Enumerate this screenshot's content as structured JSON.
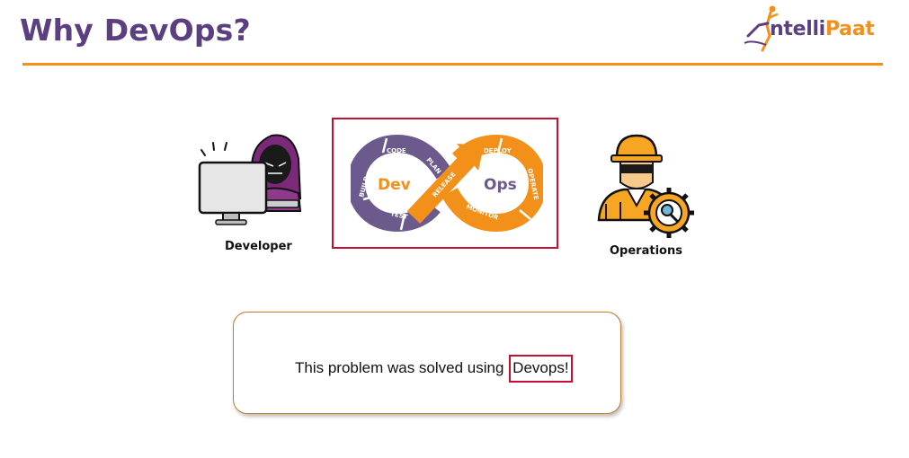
{
  "slide": {
    "title": "Why DevOps?"
  },
  "logo": {
    "text_prefix": "ntelli",
    "text_suffix": "Paat",
    "prefix_color": "#5b3f80",
    "suffix_color": "#f39019"
  },
  "figures": {
    "developer_label": "Developer",
    "operations_label": "Operations"
  },
  "devops_loop": {
    "left_word": "Dev",
    "right_word": "Ops",
    "stages": {
      "code": "CODE",
      "plan": "PLAN",
      "build": "BUILD",
      "test": "TEST",
      "release": "RELEASE",
      "deploy": "DEPLOY",
      "operate": "OPERATE",
      "monitor": "MONITOR"
    },
    "dev_color": "#6c5a8c",
    "ops_color": "#f39019"
  },
  "message": {
    "text": "This problem was solved using ",
    "highlight": "Devops!"
  },
  "colors": {
    "title": "#5b3f80",
    "rule": "#f39019",
    "highlight_border": "#c8102e"
  }
}
